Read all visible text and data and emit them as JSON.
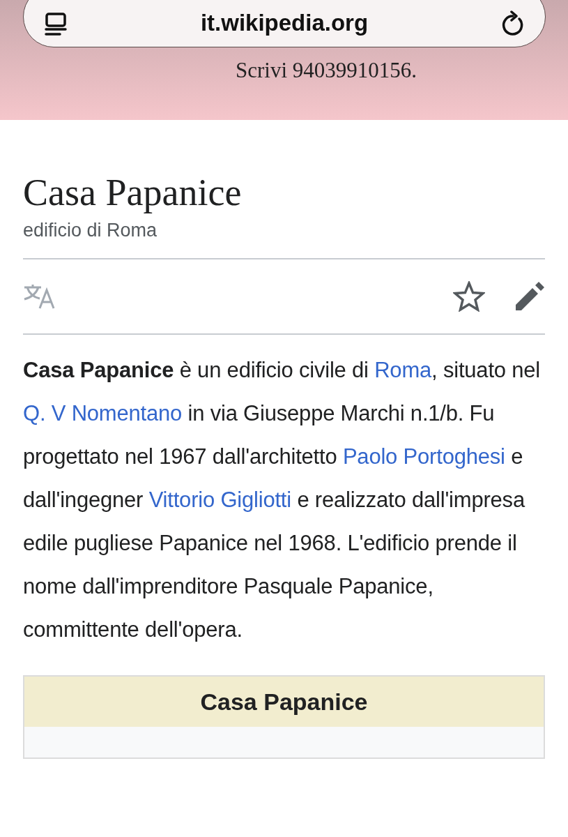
{
  "browser": {
    "url": "it.wikipedia.org"
  },
  "banner": {
    "text": "Scrivi 94039910156."
  },
  "article": {
    "title": "Casa Papanice",
    "subtitle": "edificio di Roma",
    "intro": [
      {
        "kind": "bold",
        "text": "Casa Papanice"
      },
      {
        "kind": "plain",
        "text": " è un edificio civile di "
      },
      {
        "kind": "link",
        "text": "Roma"
      },
      {
        "kind": "plain",
        "text": ", situato nel "
      },
      {
        "kind": "link",
        "text": "Q. V Nomentano"
      },
      {
        "kind": "plain",
        "text": " in via Giuseppe Marchi n.1/b. Fu progettato nel 1967 dall'architetto "
      },
      {
        "kind": "link",
        "text": "Paolo Portoghesi"
      },
      {
        "kind": "plain",
        "text": " e dall'ingegner "
      },
      {
        "kind": "link",
        "text": "Vittorio Gigliotti"
      },
      {
        "kind": "plain",
        "text": " e realizzato dall'impresa edile pugliese Papanice nel 1968. L'edificio prende il nome dall'imprenditore Pasquale Papanice, committente dell'opera."
      }
    ]
  },
  "infobox": {
    "title": "Casa Papanice"
  }
}
